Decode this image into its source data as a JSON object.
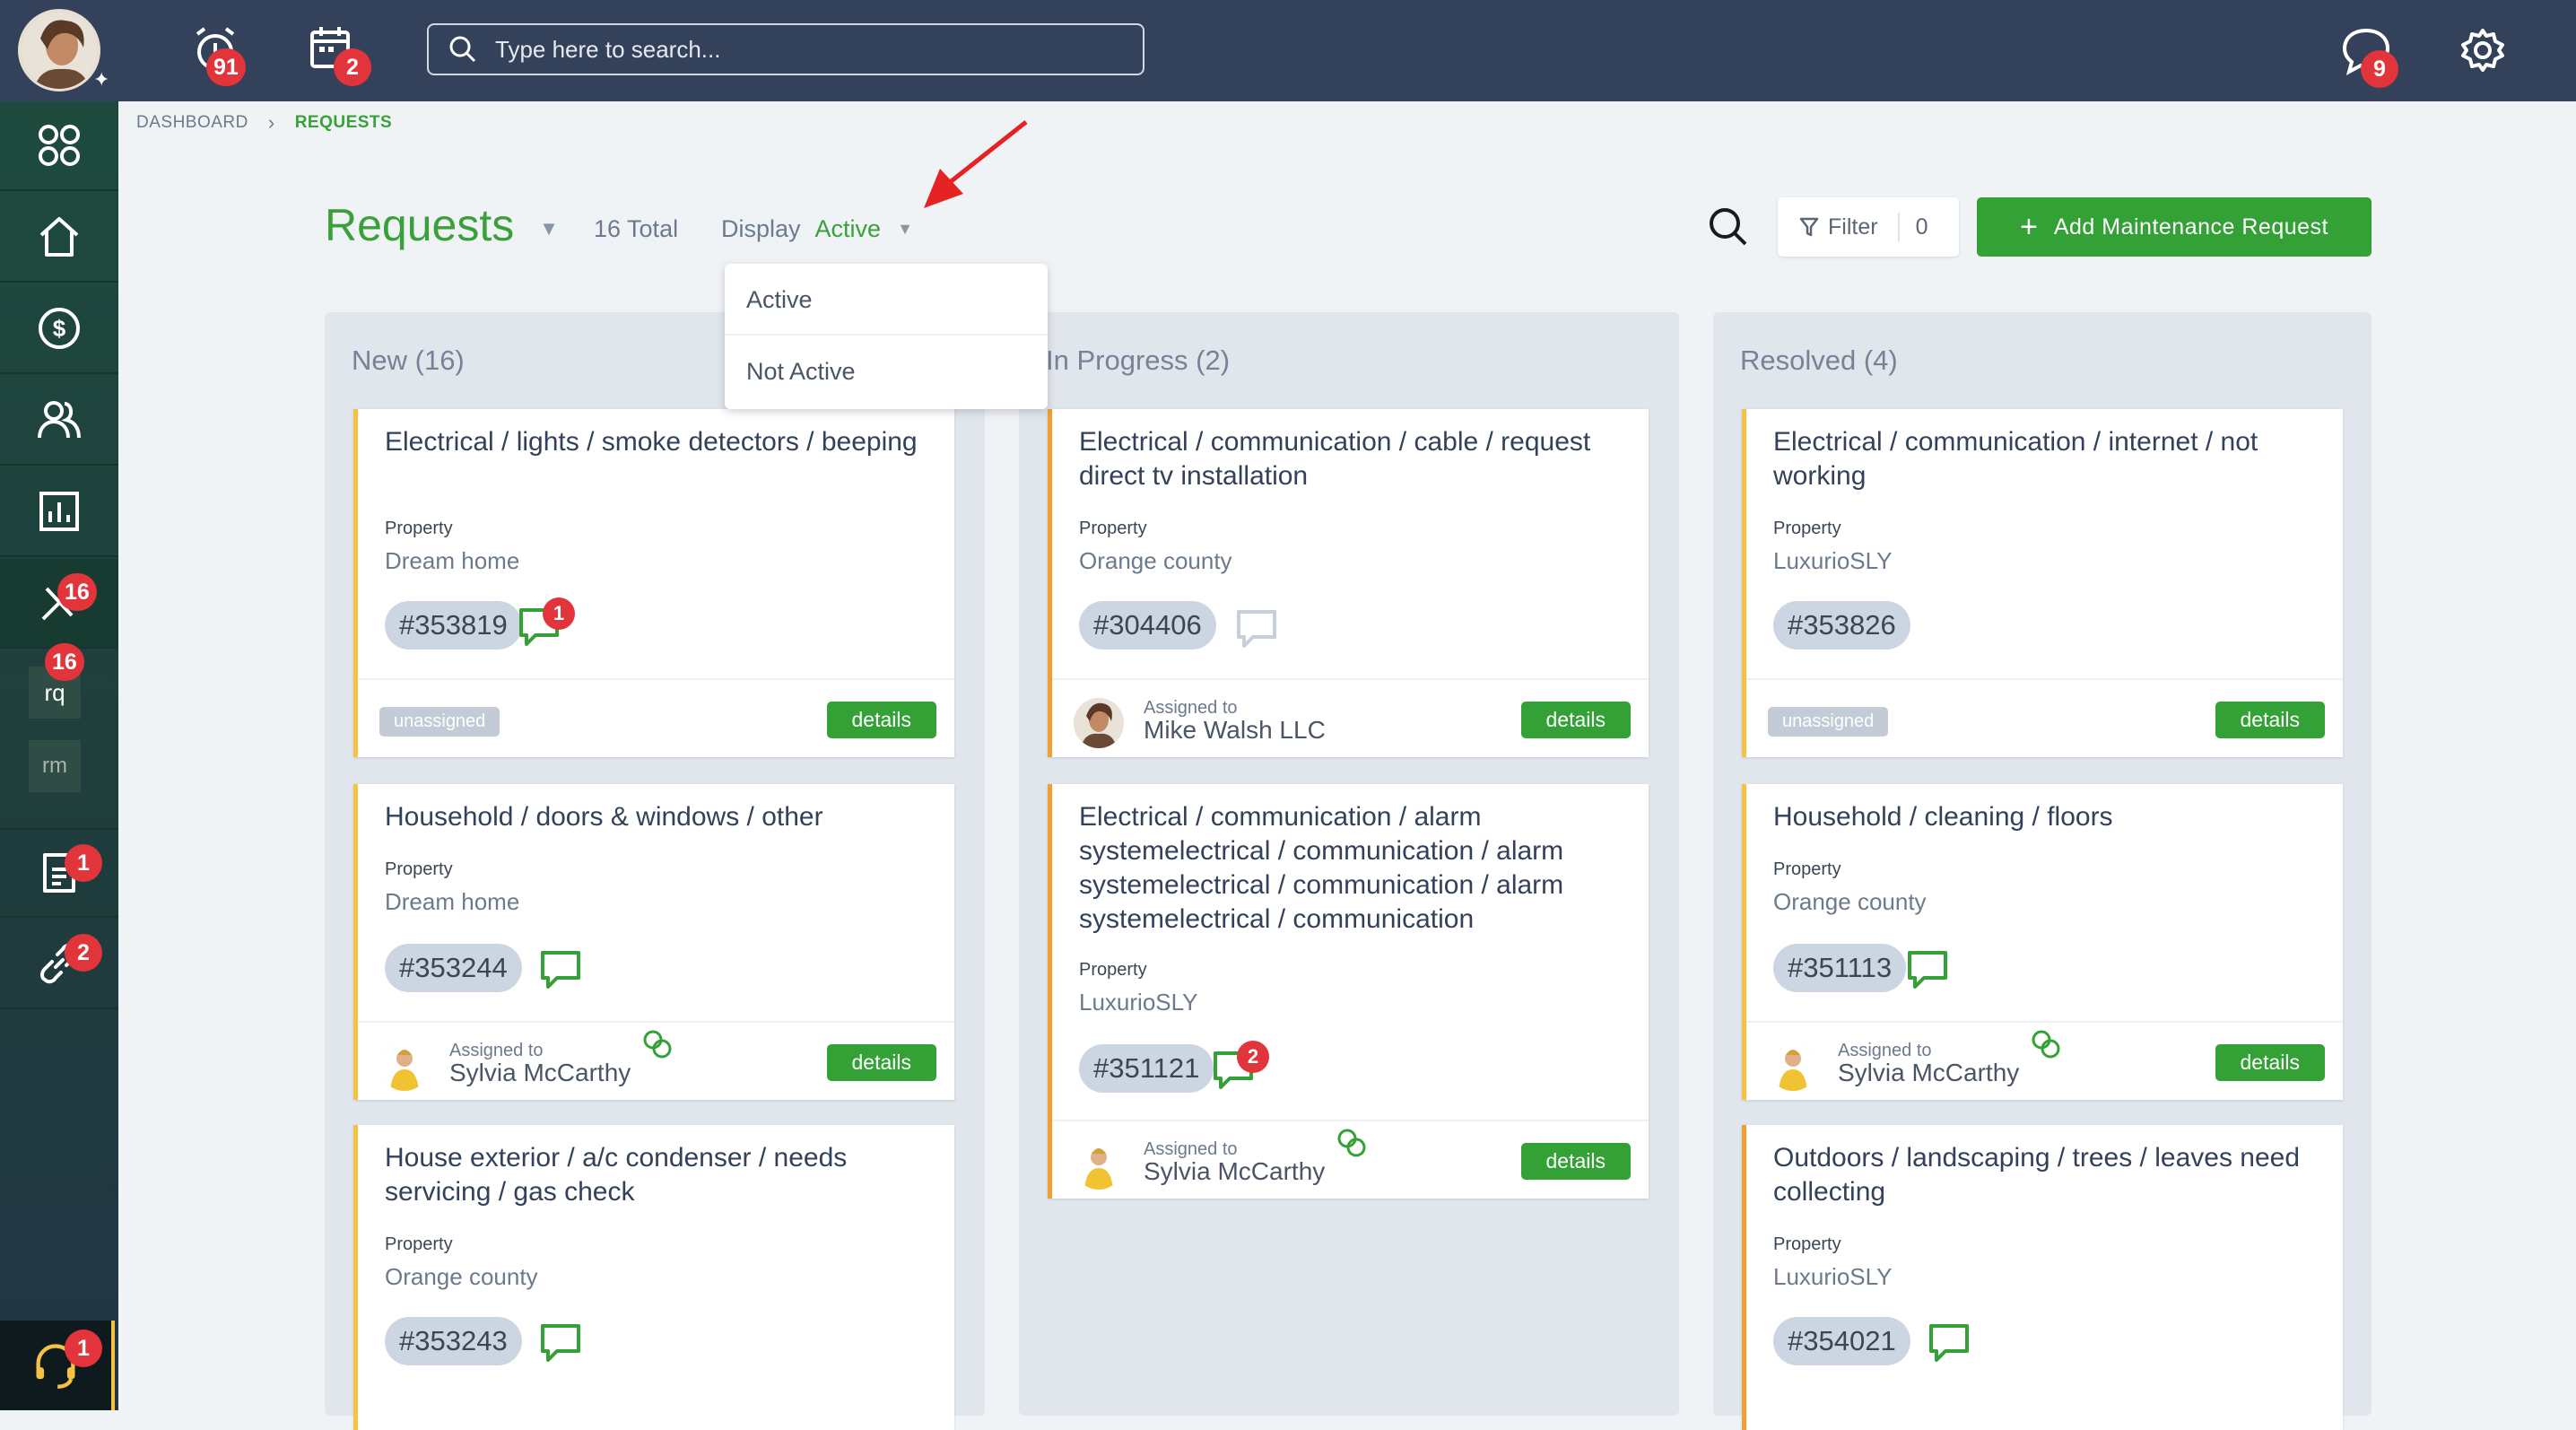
{
  "topbar": {
    "alarm_count": "91",
    "calendar_count": "2",
    "search_placeholder": "Type here to search...",
    "messages_count": "9"
  },
  "sidebar": {
    "maintenance_badge": "16",
    "rq_label": "rq",
    "rq_badge": "16",
    "rm_label": "rm",
    "documents_badge": "1",
    "links_badge": "2",
    "support_badge": "1"
  },
  "breadcrumb": {
    "root": "DASHBOARD",
    "current": "REQUESTS"
  },
  "header": {
    "title": "Requests",
    "total": "16 Total",
    "display_label": "Display",
    "display_value": "Active",
    "filter_label": "Filter",
    "filter_count": "0",
    "add_label": "Add Maintenance Request"
  },
  "display_menu": [
    "Active",
    "Not Active"
  ],
  "labels": {
    "property": "Property",
    "assigned_to": "Assigned to",
    "unassigned": "unassigned",
    "details": "details"
  },
  "columns": [
    {
      "title": "New (16)",
      "cards": [
        {
          "title": "Electrical / lights / smoke detectors / beeping",
          "property": "Dream home",
          "id": "#353819",
          "msg_badge": "1",
          "assignee": null
        },
        {
          "title": "Household / doors & windows / other",
          "property": "Dream home",
          "id": "#353244",
          "msg_badge": null,
          "assignee": "Sylvia McCarthy"
        },
        {
          "title": "House exterior / a/c condenser / needs servicing / gas check",
          "property": "Orange county",
          "id": "#353243",
          "msg_badge": null,
          "assignee": null
        }
      ]
    },
    {
      "title": "In Progress (2)",
      "cards": [
        {
          "title": "Electrical / communication / cable / request direct tv installation",
          "property": "Orange county",
          "id": "#304406",
          "msg_badge": null,
          "assignee": "Mike Walsh LLC"
        },
        {
          "title": "Electrical / communication / alarm systemelectrical / communication / alarm systemelectrical / communication / alarm systemelectrical / communication",
          "property": "LuxurioSLY",
          "id": "#351121",
          "msg_badge": "2",
          "assignee": "Sylvia McCarthy"
        }
      ]
    },
    {
      "title": "Resolved (4)",
      "cards": [
        {
          "title": "Electrical / communication / internet / not working",
          "property": "LuxurioSLY",
          "id": "#353826",
          "msg_badge": null,
          "assignee": null
        },
        {
          "title": "Household / cleaning / floors",
          "property": "Orange county",
          "id": "#351113",
          "msg_badge": null,
          "assignee": "Sylvia McCarthy"
        },
        {
          "title": "Outdoors / landscaping / trees / leaves need collecting",
          "property": "LuxurioSLY",
          "id": "#354021",
          "msg_badge": null,
          "assignee": null
        }
      ]
    }
  ],
  "colors": {
    "accent": "#3aa13a",
    "topbar": "#33415a",
    "badge": "#e2343b",
    "card_border_new": "#f5c243",
    "card_border_progress": "#f0a032"
  }
}
